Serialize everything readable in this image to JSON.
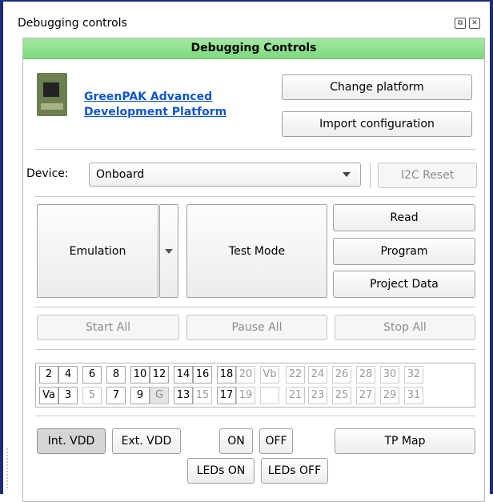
{
  "window": {
    "title": "Debugging controls",
    "icons": [
      "float-icon",
      "close-icon"
    ]
  },
  "header": {
    "title": "Debugging Controls",
    "color": "#8ade8a"
  },
  "platform": {
    "link_line1": "GreenPAK Advanced",
    "link_line2": "Development Platform",
    "change_label": "Change platform",
    "import_label": "Import configuration"
  },
  "device": {
    "label": "Device:",
    "value": "Onboard",
    "i2c_reset_label": "I2C Reset"
  },
  "controls": {
    "emulation_label": "Emulation",
    "test_mode_label": "Test Mode",
    "read_label": "Read",
    "program_label": "Program",
    "project_data_label": "Project Data"
  },
  "run": {
    "start_all": "Start All",
    "pause_all": "Pause All",
    "stop_all": "Stop All"
  },
  "pins": {
    "row1": [
      "2",
      "4",
      "6",
      "8",
      "10",
      "12",
      "14",
      "16",
      "18",
      "20",
      "Vb",
      "22",
      "24",
      "26",
      "28",
      "30",
      "32"
    ],
    "row2": [
      "Va",
      "3",
      "5",
      "7",
      "9",
      "G",
      "13",
      "15",
      "17",
      "19",
      "",
      "21",
      "23",
      "25",
      "27",
      "29",
      "31"
    ]
  },
  "power": {
    "int_vdd": "Int. VDD",
    "ext_vdd": "Ext. VDD",
    "on": "ON",
    "off": "OFF",
    "tp_map": "TP Map",
    "leds_on": "LEDs ON",
    "leds_off": "LEDs OFF"
  }
}
